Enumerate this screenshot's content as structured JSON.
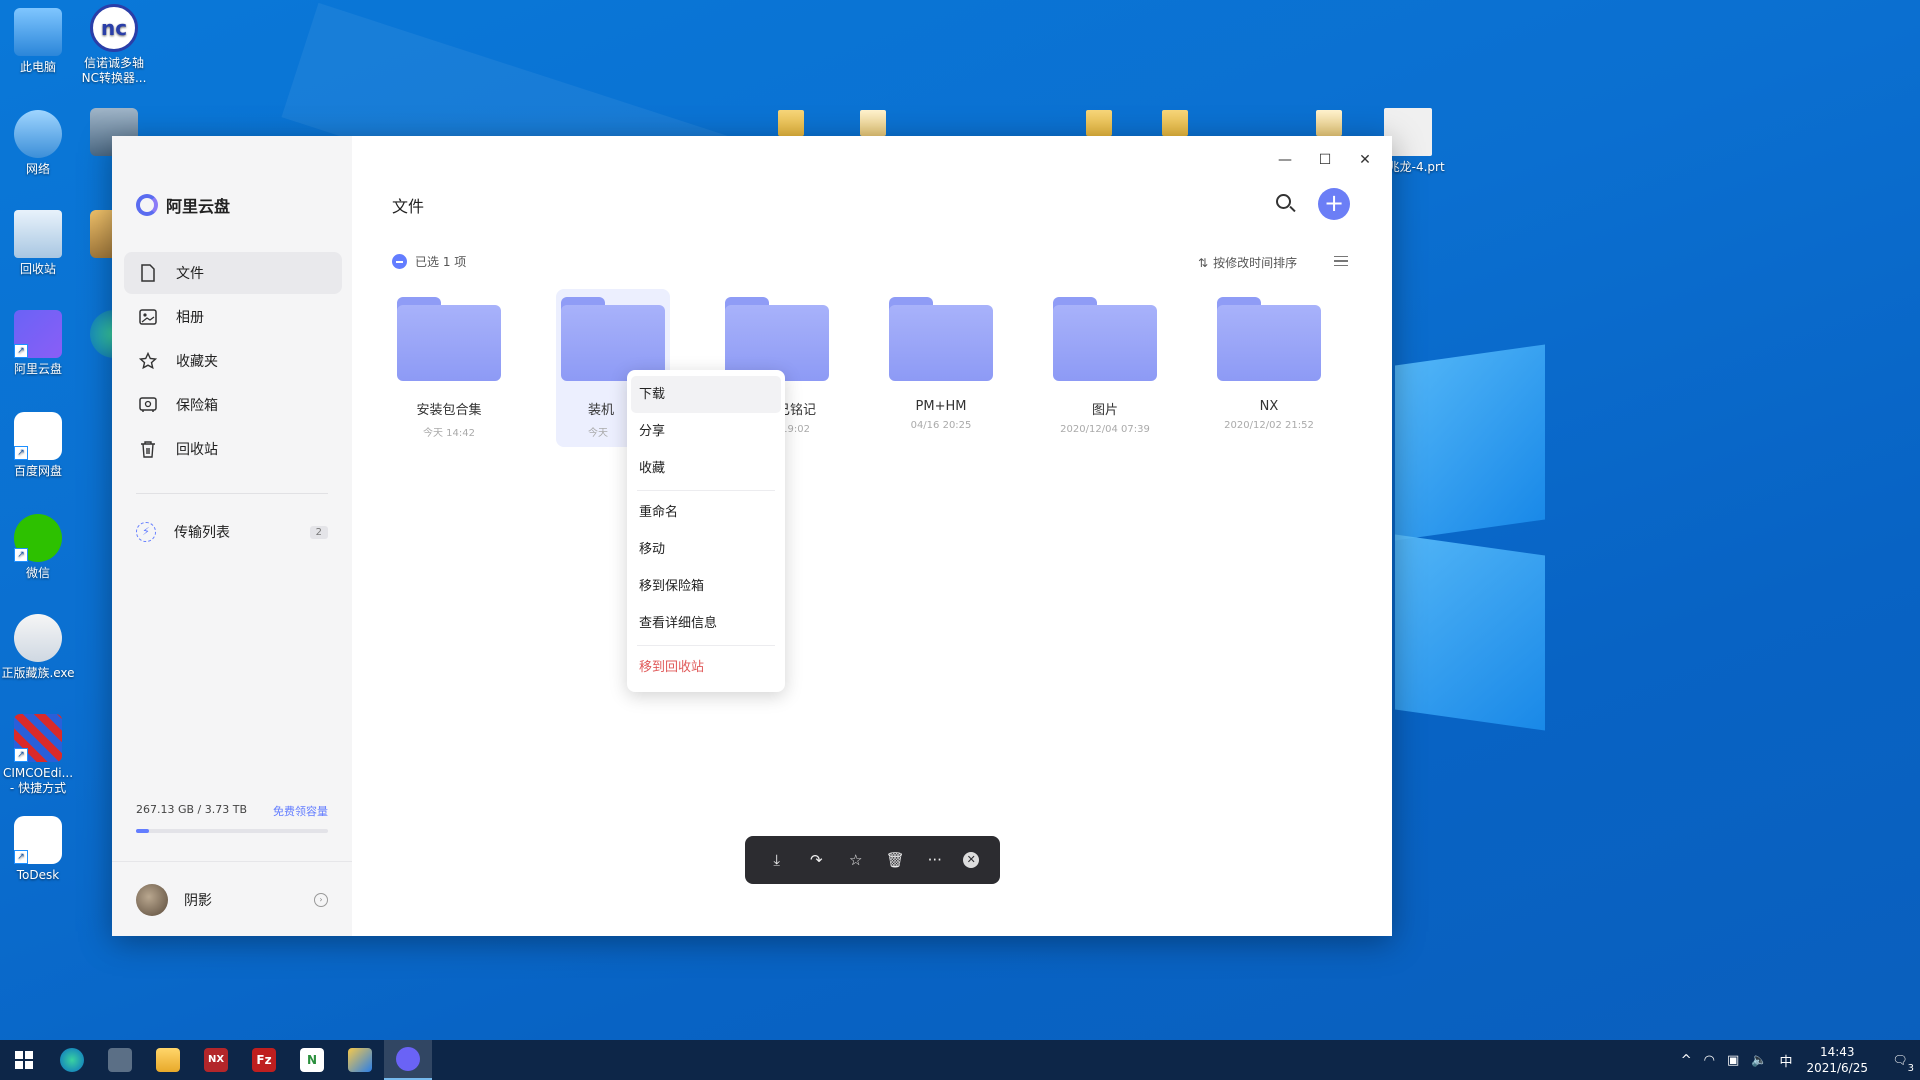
{
  "desktop": {
    "icons": [
      {
        "label": "此电脑"
      },
      {
        "label": "信诺诚多轴NC转换器..."
      },
      {
        "label": "网络"
      },
      {
        "label": "回收站"
      },
      {
        "label": "阿里云盘"
      },
      {
        "label": "百度网盘"
      },
      {
        "label": "微信"
      },
      {
        "label": "正版藏族.exe"
      },
      {
        "label": "CIMCOEdi... - 快捷方式"
      },
      {
        "label": "ToDesk"
      },
      {
        "label": "-仇兆龙-4.prt"
      }
    ]
  },
  "app": {
    "brand": "阿里云盘",
    "nav": [
      {
        "label": "文件",
        "icon": "file-icon"
      },
      {
        "label": "相册",
        "icon": "photo-icon"
      },
      {
        "label": "收藏夹",
        "icon": "star-icon"
      },
      {
        "label": "保险箱",
        "icon": "safe-icon"
      },
      {
        "label": "回收站",
        "icon": "trash-icon"
      }
    ],
    "transfer": {
      "label": "传输列表",
      "count": "2"
    },
    "storage": {
      "used": "267.13 GB / 3.73 TB",
      "link": "免费领容量",
      "fraction": 0.07
    },
    "user": {
      "name": "阴影"
    },
    "main": {
      "title": "文件",
      "selection": "已选 1 项",
      "sort": "按修改时间排序",
      "files": [
        {
          "name": "安装包合集",
          "date": "今天 14:42"
        },
        {
          "name": "装机",
          "date": "今天"
        },
        {
          "name": "月已铭记",
          "date": "2 19:02"
        },
        {
          "name": "PM+HM",
          "date": "04/16 20:25"
        },
        {
          "name": "图片",
          "date": "2020/12/04 07:39"
        },
        {
          "name": "NX",
          "date": "2020/12/02 21:52"
        }
      ]
    },
    "context_menu": {
      "items": [
        "下载",
        "分享",
        "收藏",
        "重命名",
        "移动",
        "移到保险箱",
        "查看详细信息",
        "移到回收站"
      ]
    }
  },
  "taskbar": {
    "ime": "中",
    "time": "14:43",
    "date": "2021/6/25",
    "notifications": "3"
  },
  "colors": {
    "accent": "#637dff",
    "folder": "#9aa6f8",
    "danger": "#e05a5a",
    "taskbar": "#0d2648"
  }
}
